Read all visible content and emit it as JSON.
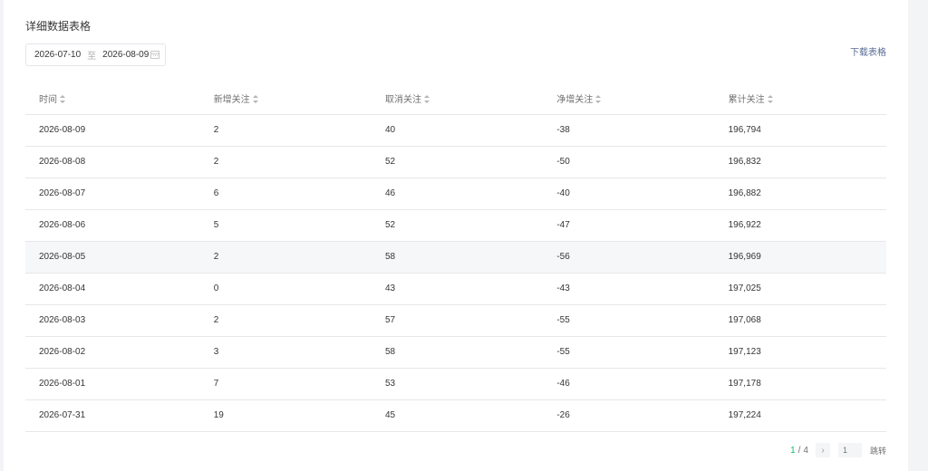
{
  "section_title": "详细数据表格",
  "date_range": {
    "start": "2026-07-10",
    "separator": "至",
    "end": "2026-08-09"
  },
  "download_label": "下载表格",
  "table": {
    "columns": [
      "时间",
      "新增关注",
      "取消关注",
      "净增关注",
      "累计关注"
    ],
    "rows": [
      [
        "2026-08-09",
        "2",
        "40",
        "-38",
        "196,794"
      ],
      [
        "2026-08-08",
        "2",
        "52",
        "-50",
        "196,832"
      ],
      [
        "2026-08-07",
        "6",
        "46",
        "-40",
        "196,882"
      ],
      [
        "2026-08-06",
        "5",
        "52",
        "-47",
        "196,922"
      ],
      [
        "2026-08-05",
        "2",
        "58",
        "-56",
        "196,969"
      ],
      [
        "2026-08-04",
        "0",
        "43",
        "-43",
        "197,025"
      ],
      [
        "2026-08-03",
        "2",
        "57",
        "-55",
        "197,068"
      ],
      [
        "2026-08-02",
        "3",
        "58",
        "-55",
        "197,123"
      ],
      [
        "2026-08-01",
        "7",
        "53",
        "-46",
        "197,178"
      ],
      [
        "2026-07-31",
        "19",
        "45",
        "-26",
        "197,224"
      ]
    ],
    "hover_row": 4
  },
  "pagination": {
    "current": "1",
    "separator": "/",
    "total": "4",
    "input_placeholder": "1",
    "jump_label": "跳转"
  },
  "colors": {
    "accent": "#07c160",
    "link": "#576b95"
  }
}
